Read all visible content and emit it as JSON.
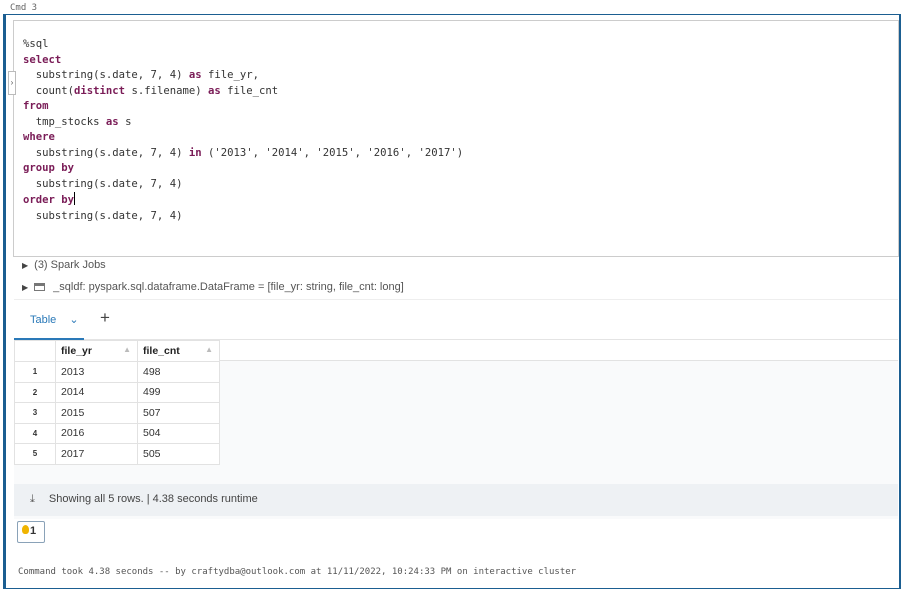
{
  "cell_label": "Cmd 3",
  "code": [
    [
      [
        "t",
        "%sql"
      ]
    ],
    [
      [
        "k",
        "select"
      ]
    ],
    [
      [
        "t",
        "  substring(s.date, 7, 4) "
      ],
      [
        "k",
        "as"
      ],
      [
        "t",
        " file_yr,"
      ]
    ],
    [
      [
        "t",
        "  count("
      ],
      [
        "k",
        "distinct"
      ],
      [
        "t",
        " s.filename) "
      ],
      [
        "k",
        "as"
      ],
      [
        "t",
        " file_cnt"
      ]
    ],
    [
      [
        "k",
        "from"
      ]
    ],
    [
      [
        "t",
        "  tmp_stocks "
      ],
      [
        "k",
        "as"
      ],
      [
        "t",
        " s"
      ]
    ],
    [
      [
        "k",
        "where"
      ]
    ],
    [
      [
        "t",
        "  substring(s.date, 7, 4) "
      ],
      [
        "k",
        "in"
      ],
      [
        "t",
        " ('2013', '2014', '2015', '2016', '2017')"
      ]
    ],
    [
      [
        "k",
        "group by"
      ]
    ],
    [
      [
        "t",
        "  substring(s.date, 7, 4)"
      ]
    ],
    [
      [
        "k",
        "order by"
      ],
      [
        "c",
        ""
      ]
    ],
    [
      [
        "t",
        "  substring(s.date, 7, 4)"
      ]
    ]
  ],
  "spark_jobs": "(3) Spark Jobs",
  "dataframe": "_sqldf:  pyspark.sql.dataframe.DataFrame = [file_yr: string, file_cnt: long]",
  "tab_label": "Table",
  "tab_chevron": "⌄",
  "add_label": "+",
  "columns": [
    "file_yr",
    "file_cnt"
  ],
  "rows": [
    [
      "1",
      "2013",
      "498"
    ],
    [
      "2",
      "2014",
      "499"
    ],
    [
      "3",
      "2015",
      "507"
    ],
    [
      "4",
      "2016",
      "504"
    ],
    [
      "5",
      "2017",
      "505"
    ]
  ],
  "footer": "Showing all 5 rows.  |  4.38 seconds runtime",
  "bulb_count": "1",
  "command_took": "Command took 4.38 seconds -- by craftydba@outlook.com at 11/11/2022, 10:24:33 PM on interactive cluster"
}
